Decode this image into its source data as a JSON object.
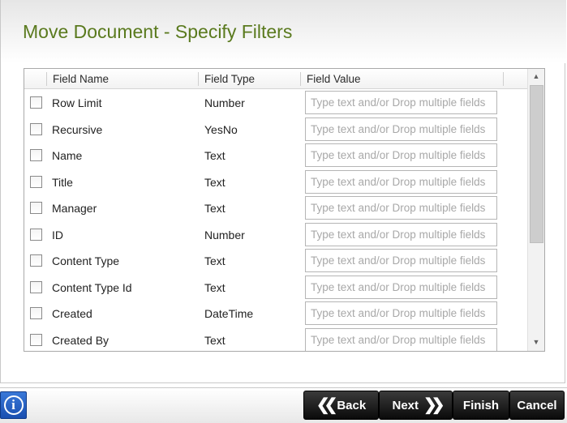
{
  "dialog": {
    "title": "Move Document - Specify Filters"
  },
  "grid": {
    "columns": [
      "Field Name",
      "Field Type",
      "Field Value"
    ],
    "value_placeholder": "Type text and/or Drop multiple fields",
    "rows": [
      {
        "name": "Row Limit",
        "type": "Number"
      },
      {
        "name": "Recursive",
        "type": "YesNo"
      },
      {
        "name": "Name",
        "type": "Text"
      },
      {
        "name": "Title",
        "type": "Text"
      },
      {
        "name": "Manager",
        "type": "Text"
      },
      {
        "name": "ID",
        "type": "Number"
      },
      {
        "name": "Content Type",
        "type": "Text"
      },
      {
        "name": "Content Type Id",
        "type": "Text"
      },
      {
        "name": "Created",
        "type": "DateTime"
      },
      {
        "name": "Created By",
        "type": "Text"
      }
    ],
    "scroll_up_icon": "triangle-up",
    "scroll_down_icon": "triangle-down"
  },
  "footer": {
    "info_icon": "info-icon",
    "info_glyph": "i",
    "back_label": "Back",
    "next_label": "Next",
    "finish_label": "Finish",
    "cancel_label": "Cancel"
  },
  "colors": {
    "title": "#5a7a1e",
    "button_bg": "#0a0a0a",
    "info_bg": "#1a4fb0"
  }
}
